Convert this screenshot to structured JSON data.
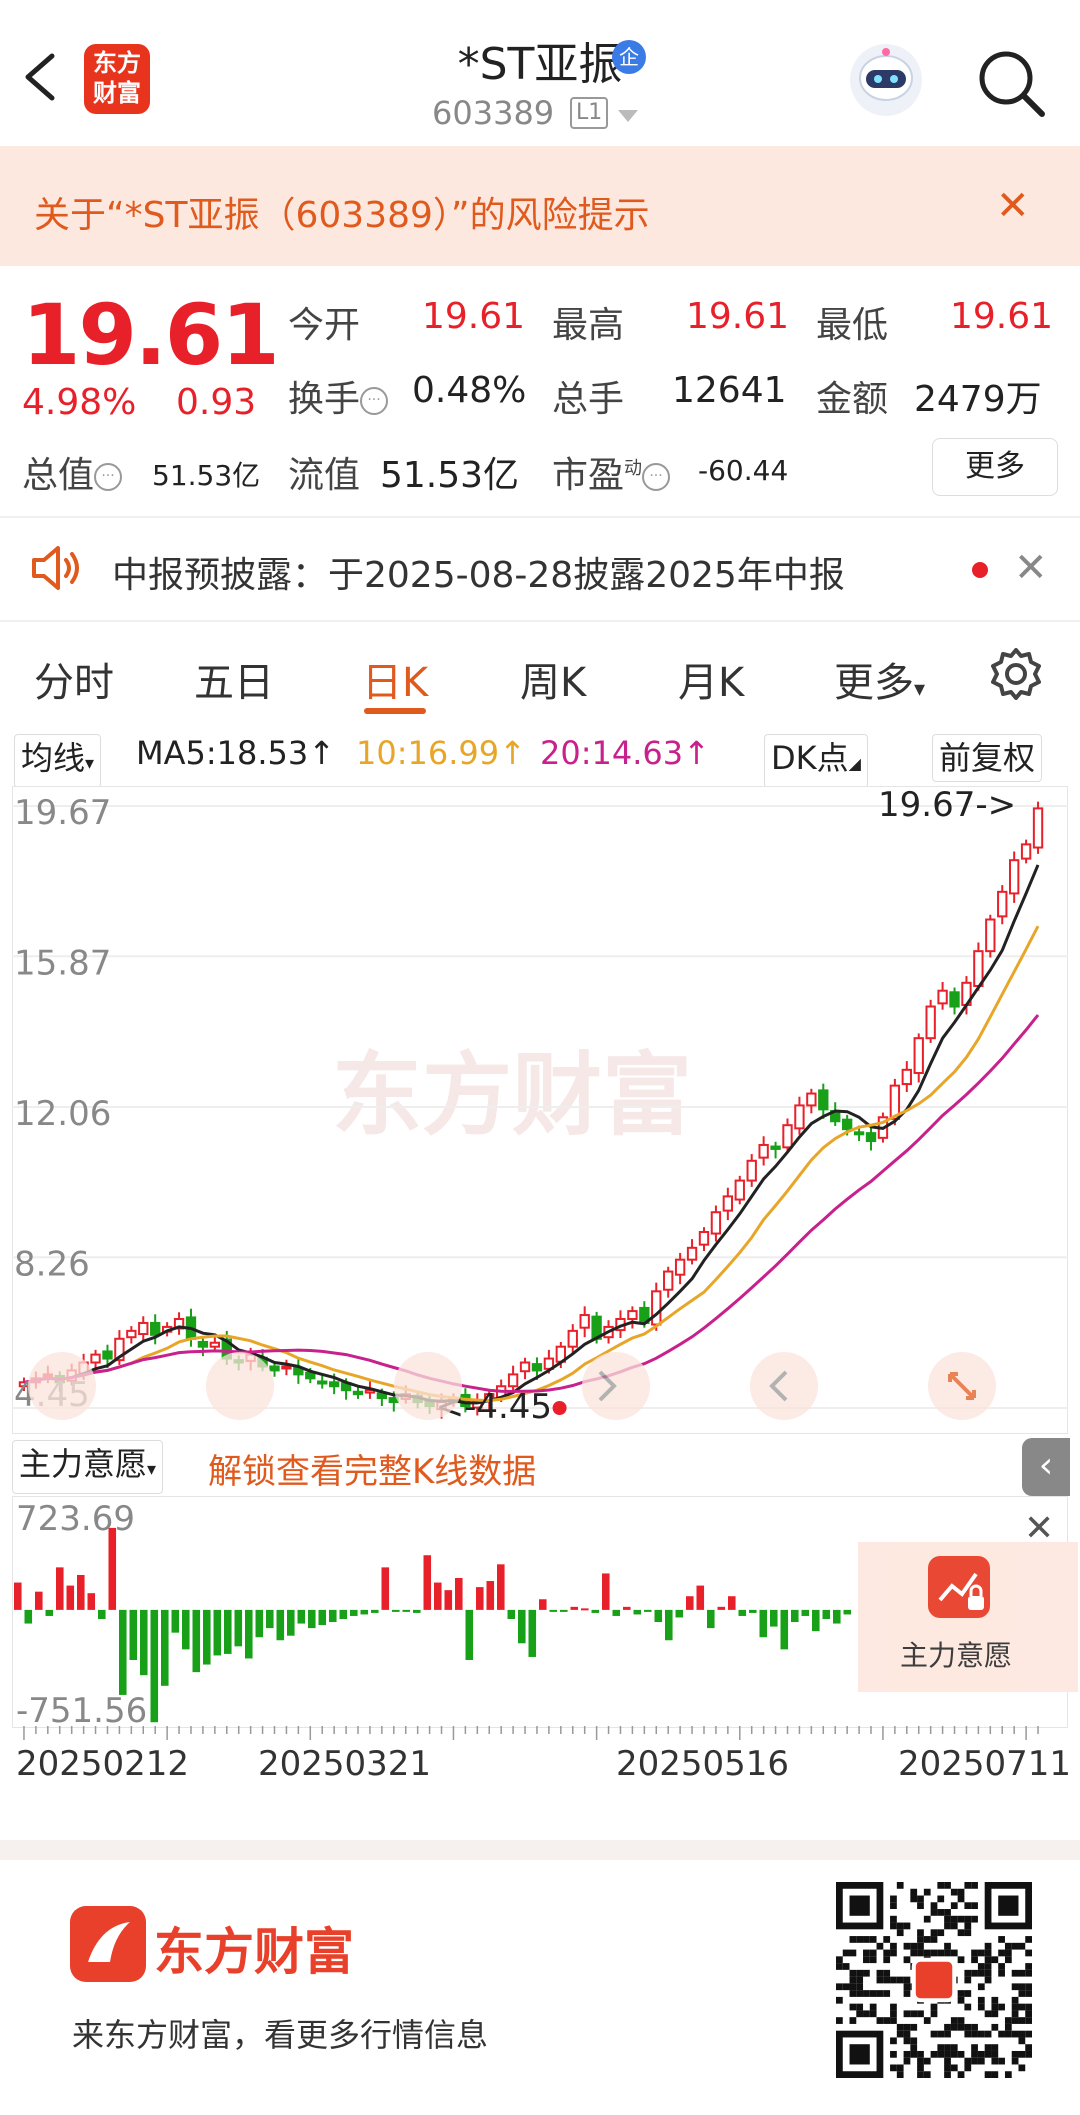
{
  "header": {
    "stock_name": "*ST亚振",
    "badge": "企",
    "stock_code": "603389",
    "level": "L1",
    "logo_text_1": "东方",
    "logo_text_2": "财富"
  },
  "risk_banner": {
    "text": "关于“*ST亚振（603389）”的风险提示"
  },
  "quote": {
    "price": "19.61",
    "change_pct": "4.98%",
    "change": "0.93",
    "open_label": "今开",
    "open": "19.61",
    "high_label": "最高",
    "high": "19.61",
    "low_label": "最低",
    "low": "19.61",
    "turnover_label": "换手",
    "turnover": "0.48%",
    "volume_label": "总手",
    "volume": "12641",
    "amount_label": "金额",
    "amount": "2479万",
    "total_value_label": "总值",
    "total_value": "51.53亿",
    "float_value_label": "流值",
    "float_value": "51.53亿",
    "pe_label": "市盈",
    "pe_sup": "动",
    "pe": "-60.44",
    "more_label": "更多"
  },
  "notice": {
    "text": "中报预披露：于2025-08-28披露2025年中报"
  },
  "tabs": [
    "分时",
    "五日",
    "日K",
    "周K",
    "月K",
    "更多"
  ],
  "active_tab": "日K",
  "ma_row": {
    "selector": "均线",
    "ma5": "MA5:18.53↑",
    "ma10": "10:16.99↑",
    "ma20": "20:14.63↑",
    "dk": "DK点",
    "adjust": "前复权"
  },
  "chart_data": {
    "type": "candlestick",
    "y_ticks": [
      "19.67",
      "15.87",
      "12.06",
      "8.26",
      "4.45"
    ],
    "ylim": [
      4.45,
      19.67
    ],
    "max_label": "19.67->",
    "min_label": "<-4.45",
    "x_ticks": [
      "20250212",
      "20250321",
      "20250516",
      "20250711"
    ],
    "watermark": "东方财富",
    "series": [
      {
        "name": "MA5",
        "color": "#222222"
      },
      {
        "name": "MA10",
        "color": "#e8a628"
      },
      {
        "name": "MA20",
        "color": "#c8208c"
      }
    ],
    "closes": [
      5.1,
      5.2,
      5.3,
      5.1,
      5.4,
      5.6,
      5.8,
      5.7,
      6.2,
      6.4,
      6.6,
      6.3,
      6.5,
      6.7,
      6.2,
      6.0,
      6.1,
      5.7,
      5.6,
      5.8,
      5.5,
      5.4,
      5.5,
      5.3,
      5.2,
      5.1,
      5.0,
      4.9,
      4.8,
      4.9,
      4.7,
      4.6,
      4.8,
      4.6,
      4.5,
      4.6,
      4.7,
      4.5,
      4.6,
      4.8,
      5.0,
      5.3,
      5.6,
      5.4,
      5.7,
      6.0,
      6.4,
      6.8,
      6.2,
      6.5,
      6.7,
      6.9,
      6.6,
      7.4,
      7.9,
      8.2,
      8.5,
      8.9,
      9.4,
      9.8,
      10.2,
      10.7,
      11.1,
      11.0,
      11.6,
      12.1,
      12.4,
      12.0,
      11.7,
      11.5,
      11.4,
      11.2,
      11.8,
      12.6,
      13.0,
      13.8,
      14.6,
      15.0,
      14.6,
      15.2,
      16.0,
      16.8,
      17.5,
      18.3,
      18.7,
      19.61
    ]
  },
  "sub_panel": {
    "selector": "主力意愿",
    "unlock_text": "解锁查看完整K线数据",
    "y_max": "723.69",
    "y_min": "-751.56",
    "bars": [
      180,
      -90,
      120,
      -40,
      280,
      160,
      230,
      110,
      -60,
      540,
      -560,
      -330,
      -430,
      -740,
      -500,
      -150,
      -260,
      -410,
      -360,
      -300,
      -290,
      -240,
      -320,
      -180,
      -120,
      -200,
      -170,
      -90,
      -120,
      -100,
      -80,
      -60,
      -40,
      -30,
      -20,
      280,
      -10,
      -5,
      -20,
      360,
      180,
      130,
      210,
      -330,
      150,
      190,
      300,
      -60,
      -220,
      -310,
      70,
      -10,
      -8,
      20,
      10,
      -20,
      240,
      -40,
      20,
      -30,
      -10,
      -80,
      -200,
      -50,
      90,
      160,
      -120,
      20,
      90,
      -40,
      -20,
      -180,
      -110,
      -260,
      -80,
      -40,
      -140,
      -60,
      -90,
      -30
    ]
  },
  "main_intent": {
    "label": "主力意愿"
  },
  "promo": {
    "brand": "东方财富",
    "slogan": "来东方财富，看更多行情信息"
  }
}
